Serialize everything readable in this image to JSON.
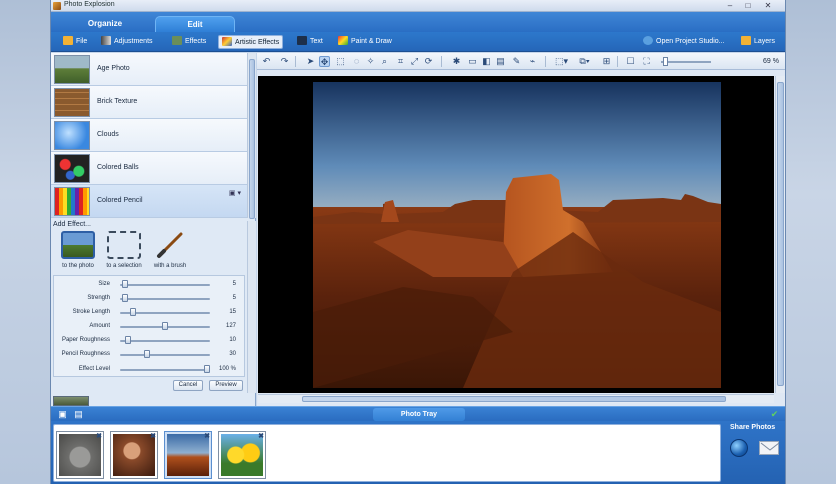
{
  "window": {
    "title": "Photo Explosion"
  },
  "mode_tabs": [
    {
      "label": "Organize"
    },
    {
      "label": "Edit"
    }
  ],
  "menu": {
    "file": "File",
    "adjustments": "Adjustments",
    "effects": "Effects",
    "artistic_effects": "Artistic Effects",
    "text": "Text",
    "paint_draw": "Paint & Draw",
    "open_project_studio": "Open Project Studio...",
    "layers": "Layers"
  },
  "effects": [
    {
      "label": "Age Photo",
      "icon": "age-photo-thumb"
    },
    {
      "label": "Brick Texture",
      "icon": "brick-texture-thumb"
    },
    {
      "label": "Clouds",
      "icon": "clouds-thumb"
    },
    {
      "label": "Colored Balls",
      "icon": "colored-balls-thumb"
    },
    {
      "label": "Colored Pencil",
      "icon": "colored-pencil-thumb"
    }
  ],
  "add_effect": {
    "title": "Add Effect...",
    "options": [
      {
        "label": "to the photo"
      },
      {
        "label": "to a selection"
      },
      {
        "label": "with a brush"
      }
    ]
  },
  "sliders": [
    {
      "label": "Size",
      "value": "5",
      "fraction": 0.02
    },
    {
      "label": "Strength",
      "value": "5",
      "fraction": 0.02
    },
    {
      "label": "Stroke Length",
      "value": "15",
      "fraction": 0.12
    },
    {
      "label": "Amount",
      "value": "127",
      "fraction": 0.5
    },
    {
      "label": "Paper Roughness",
      "value": "10",
      "fraction": 0.06
    },
    {
      "label": "Pencil Roughness",
      "value": "30",
      "fraction": 0.28
    },
    {
      "label": "Effect Level",
      "value": "100 %",
      "fraction": 1.0
    }
  ],
  "buttons": {
    "cancel": "Cancel",
    "preview": "Preview"
  },
  "zoom": {
    "text": "69 %",
    "fraction": 0.05
  },
  "tray": {
    "title": "Photo Tray",
    "share_title": "Share Photos",
    "photos": [
      {
        "name": "koala"
      },
      {
        "name": "monkey"
      },
      {
        "name": "desert"
      },
      {
        "name": "flowers"
      }
    ]
  },
  "colors": {
    "accent": "#2a6ec4",
    "toolbar": "#2566b8",
    "panel": "#dfe9f5",
    "canvas": "#000000"
  }
}
